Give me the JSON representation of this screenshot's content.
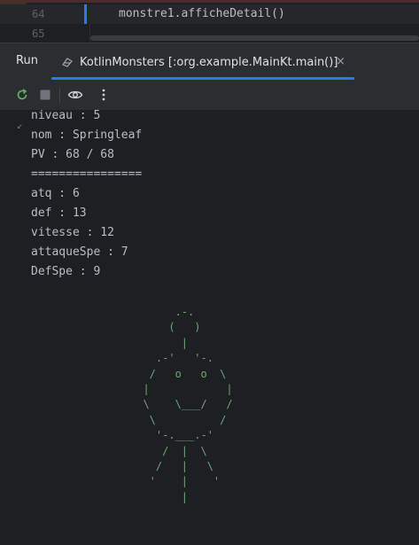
{
  "editor": {
    "lines": [
      {
        "number": "64",
        "code": "monstre1.afficheDetail()"
      },
      {
        "number": "65",
        "code": ""
      }
    ]
  },
  "tool_window": {
    "run_label": "Run",
    "config_tab_label": "KotlinMonsters [:org.example.MainKt.main()]",
    "close_glyph": "×"
  },
  "toolbar": {
    "buttons": [
      "rerun-icon",
      "stop-icon",
      "eye-icon",
      "more-vertical-icon"
    ]
  },
  "console": {
    "lines": [
      "niveau : 5",
      "nom : Springleaf",
      "PV : 68 / 68",
      "================",
      "atq : 6",
      "def : 13",
      "vitesse : 12",
      "attaqueSpe : 7",
      "DefSpe : 9"
    ],
    "ascii_art": "       .-.\n      (   )\n        |\n    .-'   '-.\n   /   o   o  \\\n  |            |\n  \\    \\___/   /\n   \\          /\n    '-.___.-'\n     /  |  \\\n    /   |   \\\n   '    |    '\n        |"
  },
  "colors": {
    "background": "#1e1f22",
    "panel": "#2b2d30",
    "accent": "#3574f0",
    "text": "#bcbec4",
    "ascii": "#6aab73"
  }
}
